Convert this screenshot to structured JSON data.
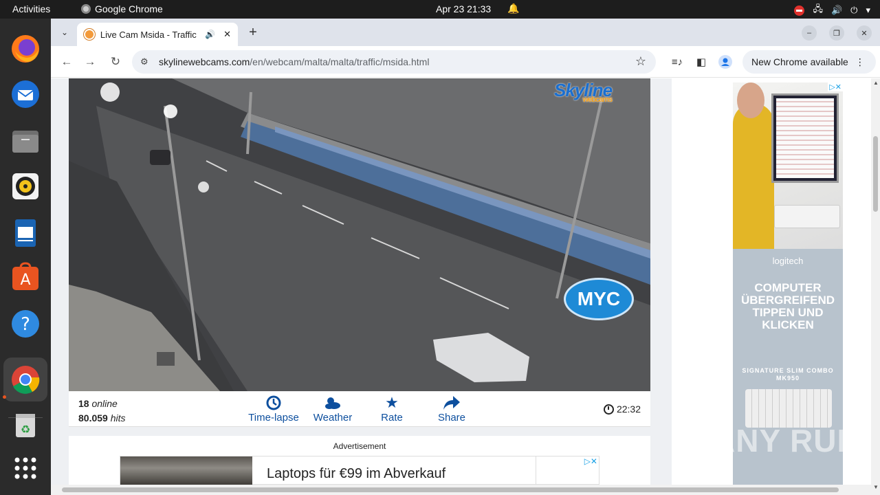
{
  "topbar": {
    "activities": "Activities",
    "app_name": "Google Chrome",
    "datetime": "Apr 23  21:33"
  },
  "dock": {
    "items": [
      "Firefox",
      "Thunderbird",
      "Files",
      "Rhythmbox",
      "LibreOffice Writer",
      "Ubuntu Software",
      "Help",
      "Google Chrome",
      "Trash",
      "Show Applications"
    ]
  },
  "browser": {
    "tab_title": "Live Cam Msida - Traffic",
    "url_domain": "skylinewebcams.com",
    "url_path": "/en/webcam/malta/malta/traffic/msida.html",
    "update_label": "New Chrome available"
  },
  "webcam": {
    "logo_main": "Skyline",
    "logo_sub": "webcams",
    "overlay_logo": "MYC"
  },
  "infobar": {
    "online_count": "18",
    "online_label": "online",
    "hits_count": "80.059",
    "hits_label": "hits",
    "buttons": [
      {
        "label": "Time-lapse",
        "icon": "timelapse-icon"
      },
      {
        "label": "Weather",
        "icon": "weather-icon"
      },
      {
        "label": "Rate",
        "icon": "star-icon"
      },
      {
        "label": "Share",
        "icon": "share-icon"
      }
    ],
    "local_time": "22:32"
  },
  "ads": {
    "label": "Advertisement",
    "banner_text": "Laptops für €99 im Abverkauf",
    "side_brand": "logitech",
    "side_headline": "COMPUTER ÜBERGREIFEND TIPPEN UND KLICKEN",
    "side_product": "SIGNATURE SLIM COMBO MK950"
  },
  "watermark": "ANY RUN"
}
